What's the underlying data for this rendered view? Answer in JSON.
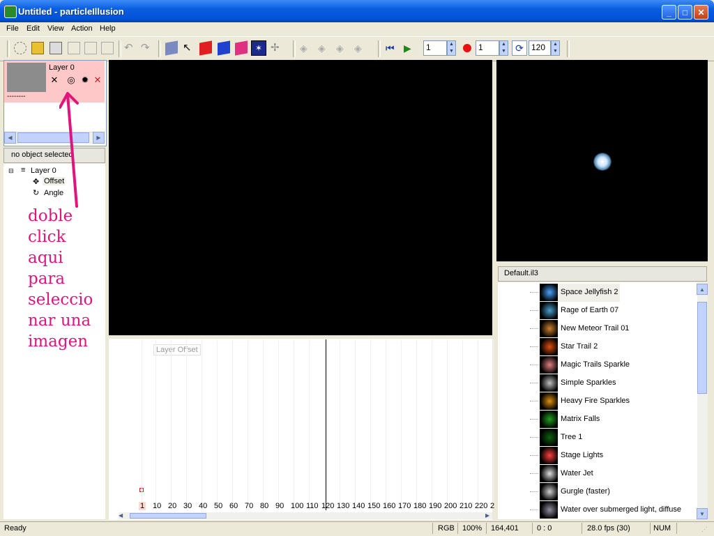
{
  "window": {
    "title": "Untitled - particleIllusion"
  },
  "menu": {
    "items": [
      "File",
      "Edit",
      "View",
      "Action",
      "Help"
    ]
  },
  "toolbar": {
    "frame_value": "1",
    "record_value": "1",
    "loop_value": "120",
    "colors": {
      "record": "#ff0000",
      "play": "#1a8a1a",
      "rewind": "#1a3aa8"
    }
  },
  "layers": {
    "name": "Layer 0",
    "dots": "--------"
  },
  "selection": {
    "header": "no object selected"
  },
  "tree": {
    "root": "Layer 0",
    "children": [
      "Offset",
      "Angle"
    ]
  },
  "annotation": {
    "lines": [
      "doble",
      "click",
      "aqui",
      "para",
      "seleccio",
      "nar una",
      "imagen"
    ],
    "color": "#e0157c"
  },
  "timeline": {
    "label": "Layer Offset",
    "ticks": [
      "1",
      "10",
      "20",
      "30",
      "40",
      "50",
      "60",
      "70",
      "80",
      "90",
      "100",
      "110",
      "120",
      "130",
      "140",
      "150",
      "160",
      "170",
      "180",
      "190",
      "200",
      "210",
      "220",
      "2"
    ]
  },
  "library": {
    "header": "Default.il3",
    "items": [
      {
        "label": "Space Jellyfish 2",
        "color": "#4aa3ff"
      },
      {
        "label": "Rage of Earth 07",
        "color": "#4aa0d0"
      },
      {
        "label": "New Meteor Trail 01",
        "color": "#d08030"
      },
      {
        "label": "Star Trail 2",
        "color": "#e05010"
      },
      {
        "label": "Magic Trails Sparkle",
        "color": "#e08080"
      },
      {
        "label": "Simple Sparkles",
        "color": "#c0c0c0"
      },
      {
        "label": "Heavy Fire Sparkles",
        "color": "#e09010"
      },
      {
        "label": "Matrix Falls",
        "color": "#20a020"
      },
      {
        "label": "Tree 1",
        "color": "#106010"
      },
      {
        "label": "Stage Lights",
        "color": "#ff4040"
      },
      {
        "label": "Water Jet",
        "color": "#e0e0e0"
      },
      {
        "label": "Gurgle (faster)",
        "color": "#d0d0d0"
      },
      {
        "label": "Water over submerged light, diffuse",
        "color": "#9090a0"
      }
    ]
  },
  "status": {
    "ready": "Ready",
    "color_mode": "RGB",
    "zoom": "100%",
    "coords": "164,401",
    "offset": "0 : 0",
    "fps": "28.0 fps (30)",
    "num": "NUM"
  }
}
